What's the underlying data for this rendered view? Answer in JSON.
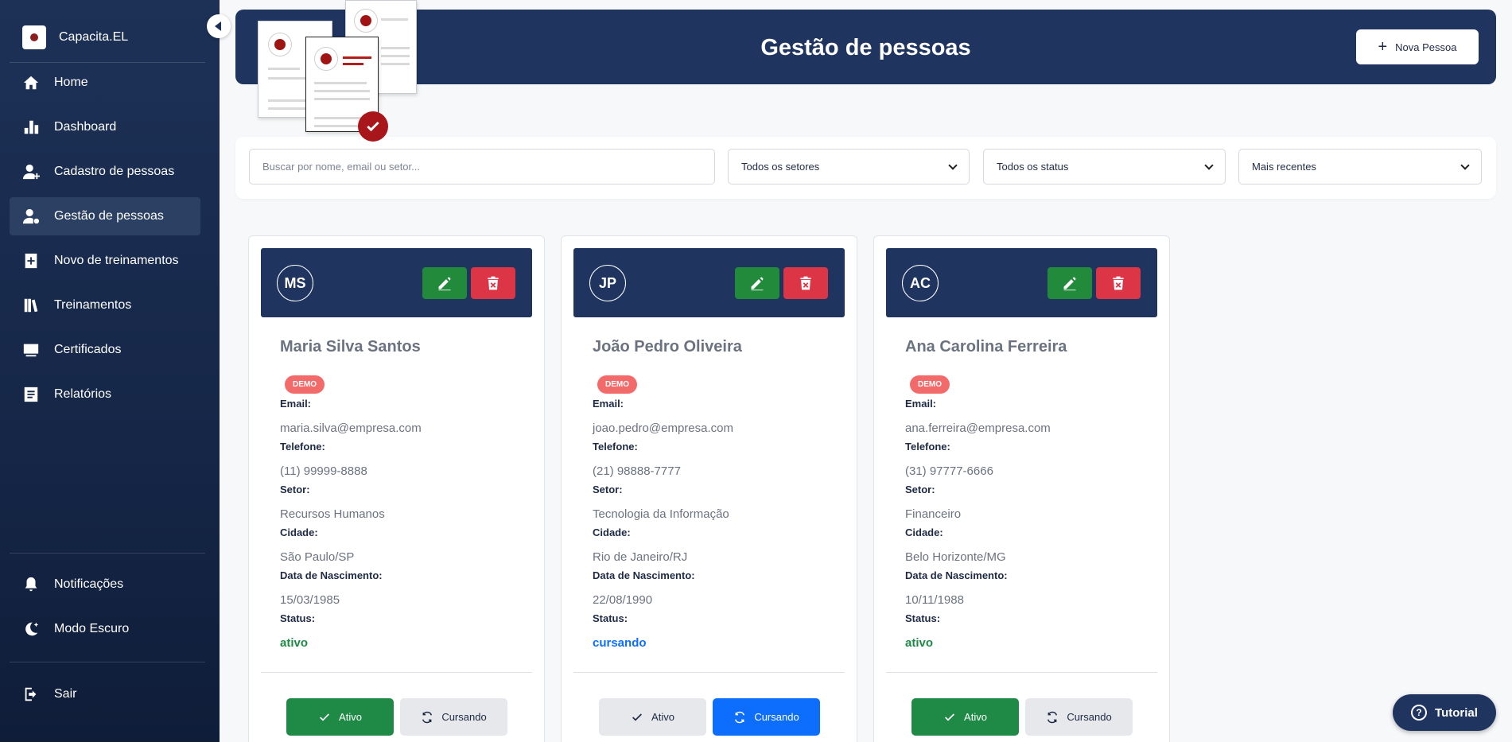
{
  "sidebar": {
    "brand": "Capacita.EL",
    "items": [
      {
        "label": "Home",
        "icon": "home-icon"
      },
      {
        "label": "Dashboard",
        "icon": "bar-chart-icon"
      },
      {
        "label": "Cadastro de pessoas",
        "icon": "user-add-icon"
      },
      {
        "label": "Gestão de pessoas",
        "icon": "user-gear-icon",
        "active": true
      },
      {
        "label": "Novo de treinamentos",
        "icon": "add-doc-icon"
      },
      {
        "label": "Treinamentos",
        "icon": "books-icon"
      },
      {
        "label": "Certificados",
        "icon": "certificate-icon"
      },
      {
        "label": "Relatórios",
        "icon": "report-icon"
      }
    ],
    "bottom": [
      {
        "label": "Notificações",
        "icon": "bell-icon"
      },
      {
        "label": "Modo Escuro",
        "icon": "moon-icon"
      }
    ],
    "logout": {
      "label": "Sair",
      "icon": "logout-icon"
    }
  },
  "header": {
    "title": "Gestão de pessoas",
    "new_button": "Nova Pessoa"
  },
  "filters": {
    "search_placeholder": "Buscar por nome, email ou setor...",
    "sector": "Todos os setores",
    "status": "Todos os status",
    "sort": "Mais recentes"
  },
  "labels": {
    "email": "Email:",
    "phone": "Telefone:",
    "sector": "Setor:",
    "city": "Cidade:",
    "birth": "Data de Nascimento:",
    "status": "Status:",
    "demo": "DEMO",
    "btn_active": "Ativo",
    "btn_studying": "Cursando"
  },
  "people": [
    {
      "initials": "MS",
      "name": "Maria Silva Santos",
      "email": "maria.silva@empresa.com",
      "phone": "(11) 99999-8888",
      "sector": "Recursos Humanos",
      "city": "São Paulo/SP",
      "birth": "15/03/1985",
      "status": "ativo"
    },
    {
      "initials": "JP",
      "name": "João Pedro Oliveira",
      "email": "joao.pedro@empresa.com",
      "phone": "(21) 98888-7777",
      "sector": "Tecnologia da Informação",
      "city": "Rio de Janeiro/RJ",
      "birth": "22/08/1990",
      "status": "cursando"
    },
    {
      "initials": "AC",
      "name": "Ana Carolina Ferreira",
      "email": "ana.ferreira@empresa.com",
      "phone": "(31) 97777-6666",
      "sector": "Financeiro",
      "city": "Belo Horizonte/MG",
      "birth": "10/11/1988",
      "status": "ativo"
    }
  ],
  "tutorial": "Tutorial",
  "colors": {
    "primary": "#1f3560",
    "active_green": "#1f8a46",
    "studying_blue": "#0d6efd",
    "delete_red": "#dc3545",
    "edit_green": "#228a3b"
  }
}
